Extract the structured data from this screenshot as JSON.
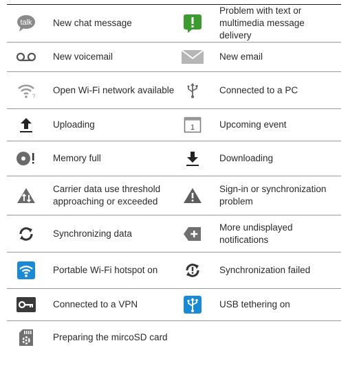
{
  "rows": [
    {
      "left": {
        "icon": "talk-chat-icon",
        "label": "New chat message"
      },
      "right": {
        "icon": "message-warning-icon",
        "label": "Problem with text or multimedia message delivery"
      }
    },
    {
      "left": {
        "icon": "voicemail-icon",
        "label": "New voicemail"
      },
      "right": {
        "icon": "email-envelope-icon",
        "label": "New email"
      }
    },
    {
      "left": {
        "icon": "open-wifi-icon",
        "label": "Open Wi-Fi network available"
      },
      "right": {
        "icon": "usb-icon",
        "label": "Connected to a PC"
      }
    },
    {
      "left": {
        "icon": "upload-icon",
        "label": "Uploading"
      },
      "right": {
        "icon": "calendar-icon",
        "label": "Upcoming event"
      }
    },
    {
      "left": {
        "icon": "memory-full-icon",
        "label": "Memory full"
      },
      "right": {
        "icon": "download-icon",
        "label": "Downloading"
      }
    },
    {
      "left": {
        "icon": "data-warning-icon",
        "label": "Carrier data use threshold approaching or exceeded"
      },
      "right": {
        "icon": "sync-warning-icon",
        "label": "Sign-in or synchronization problem"
      }
    },
    {
      "left": {
        "icon": "sync-icon",
        "label": "Synchronizing data"
      },
      "right": {
        "icon": "more-notifications-icon",
        "label": "More undisplayed notifications"
      }
    },
    {
      "left": {
        "icon": "hotspot-icon",
        "label": "Portable Wi-Fi hotspot on"
      },
      "right": {
        "icon": "sync-failed-icon",
        "label": "Synchronization failed"
      }
    },
    {
      "left": {
        "icon": "vpn-key-icon",
        "label": "Connected to a VPN"
      },
      "right": {
        "icon": "usb-tethering-icon",
        "label": "USB tethering on"
      }
    },
    {
      "left": {
        "icon": "sd-card-icon",
        "label": "Preparing the mircoSD card"
      },
      "right": null
    }
  ],
  "icon_text": {
    "talk": "talk",
    "calendar_day": "1"
  },
  "colors": {
    "green": "#3c9b2f",
    "gray": "#7a7a7a",
    "blue": "#1a8ad4",
    "rule": "#1a1a1a"
  }
}
